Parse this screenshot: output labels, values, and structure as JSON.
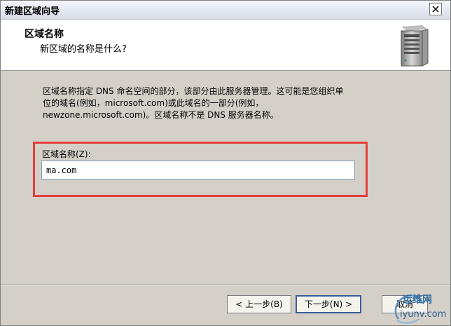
{
  "window": {
    "title": "新建区域向导"
  },
  "header": {
    "title": "区域名称",
    "subtitle": "新区域的名称是什么?"
  },
  "description": {
    "line1": "区域名称指定 DNS 命名空间的部分，该部分由此服务器管理。这可能是您组织单",
    "line2": "位的域名(例如，microsoft.com)或此域名的一部分(例如，",
    "line3": "newzone.microsoft.com)。区域名称不是 DNS 服务器名称。"
  },
  "zone_name": {
    "label": "区域名称(Z):",
    "value": "ma.com"
  },
  "buttons": {
    "back": "< 上一步(B)",
    "next": "下一步(N) >",
    "cancel": "取消"
  },
  "watermark": {
    "text1": "运维网",
    "text2": "iyunv.com"
  },
  "colors": {
    "highlight": "#e63d3d",
    "dialog_bg": "#d4d0c8"
  }
}
